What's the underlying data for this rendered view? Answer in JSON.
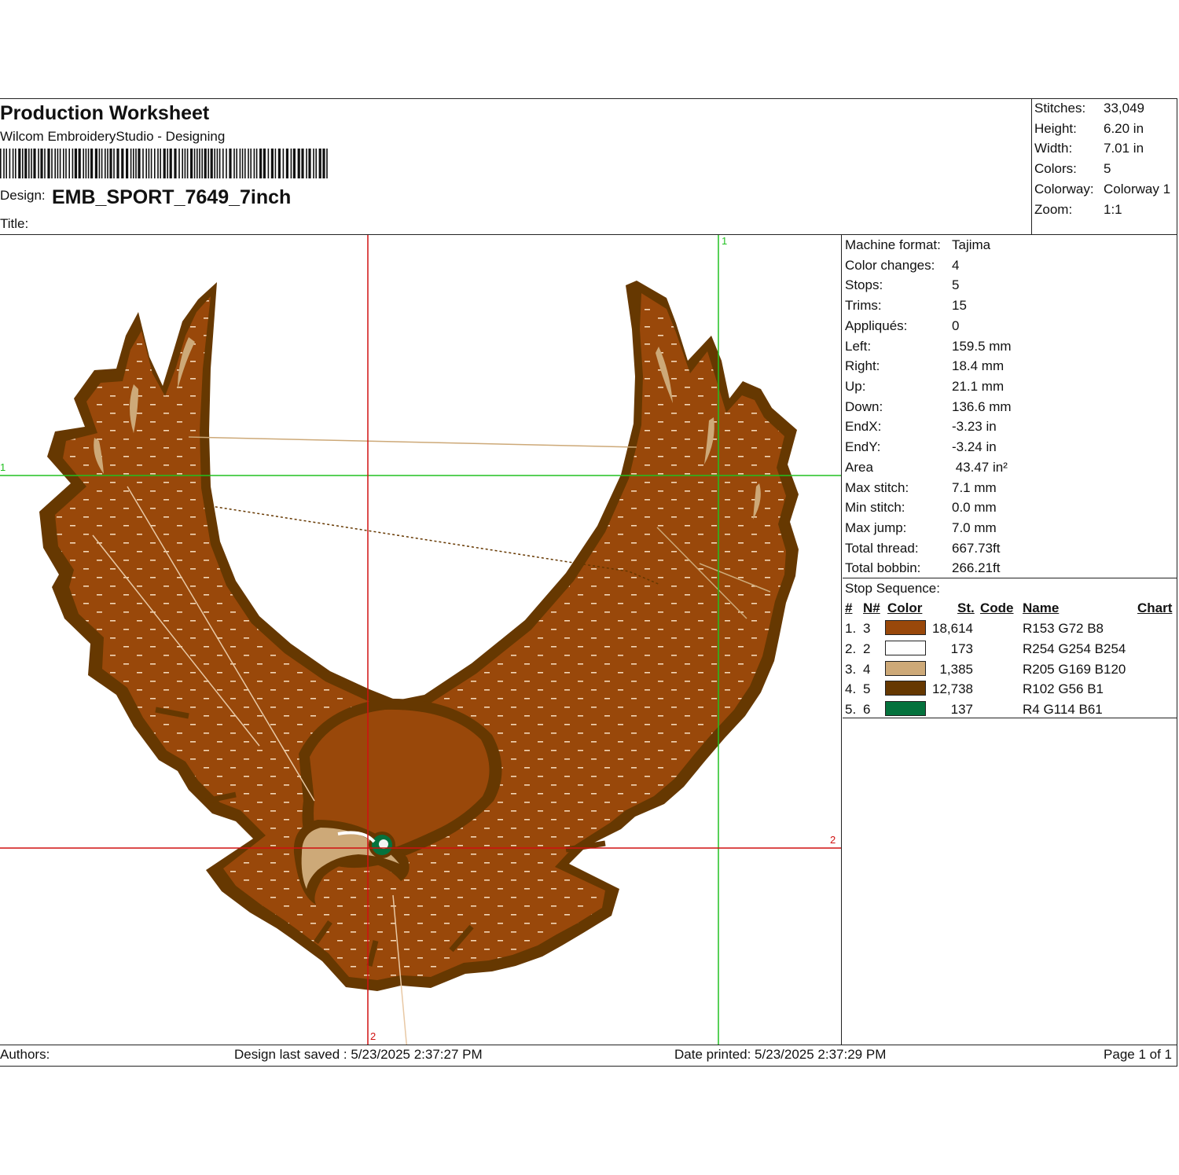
{
  "header": {
    "title": "Production Worksheet",
    "software": "Wilcom EmbroideryStudio - Designing",
    "design_label": "Design:",
    "design_name": "EMB_SPORT_7649_7inch",
    "title_label": "Title:"
  },
  "summary": [
    {
      "label": "Stitches:",
      "value": "33,049"
    },
    {
      "label": "Height:",
      "value": "6.20 in"
    },
    {
      "label": "Width:",
      "value": "7.01 in"
    },
    {
      "label": "Colors:",
      "value": "5"
    },
    {
      "label": "Colorway:",
      "value": "Colorway 1"
    },
    {
      "label": "Zoom:",
      "value": "1:1"
    }
  ],
  "machine_info": [
    {
      "label": "Machine format:",
      "value": "Tajima"
    },
    {
      "label": "Color changes:",
      "value": "4"
    },
    {
      "label": "Stops:",
      "value": "5"
    },
    {
      "label": "Trims:",
      "value": "15"
    },
    {
      "label": "Appliqués:",
      "value": "0"
    },
    {
      "label": "Left:",
      "value": "159.5 mm"
    },
    {
      "label": "Right:",
      "value": "18.4 mm"
    },
    {
      "label": "Up:",
      "value": "21.1 mm"
    },
    {
      "label": "Down:",
      "value": "136.6 mm"
    },
    {
      "label": "EndX:",
      "value": "-3.23 in"
    },
    {
      "label": "EndY:",
      "value": "-3.24 in"
    },
    {
      "label": "Area",
      "value": " 43.47 in²"
    },
    {
      "label": "Max stitch:",
      "value": "7.1 mm"
    },
    {
      "label": "Min stitch:",
      "value": "0.0 mm"
    },
    {
      "label": "Max jump:",
      "value": "7.0 mm"
    },
    {
      "label": "Total thread:",
      "value": "667.73ft"
    },
    {
      "label": "Total bobbin:",
      "value": "266.21ft"
    }
  ],
  "stop_sequence": {
    "title": "Stop Sequence:",
    "headers": {
      "num": "#",
      "needle": "N#",
      "color": "Color",
      "stitches": "St.",
      "code": "Code",
      "name": "Name",
      "chart": "Chart"
    },
    "rows": [
      {
        "num": "1.",
        "needle": "3",
        "swatch": "#99480a",
        "stitches": "18,614",
        "name": "R153 G72 B8"
      },
      {
        "num": "2.",
        "needle": "2",
        "swatch": "#fefefe",
        "stitches": "173",
        "name": "R254 G254 B254"
      },
      {
        "num": "3.",
        "needle": "4",
        "swatch": "#cda978",
        "stitches": "1,385",
        "name": "R205 G169 B120"
      },
      {
        "num": "4.",
        "needle": "5",
        "swatch": "#663801",
        "stitches": "12,738",
        "name": "R102 G56 B1"
      },
      {
        "num": "5.",
        "needle": "6",
        "swatch": "#04723d",
        "stitches": "137",
        "name": "R4 G114 B61"
      }
    ]
  },
  "canvas_marks": {
    "green_top": "1",
    "green_left": "1",
    "red_right": "2",
    "red_bottom": "2"
  },
  "footer": {
    "authors": "Authors:",
    "saved": "Design last saved : 5/23/2025 2:37:27 PM",
    "printed": "Date printed: 5/23/2025 2:37:29 PM",
    "page": "Page 1 of 1"
  },
  "colors": {
    "main": "#99480a",
    "outline": "#663801",
    "accent": "#cda978",
    "eye": "#04723d",
    "guide_red": "#d01010",
    "guide_green": "#20c020"
  }
}
